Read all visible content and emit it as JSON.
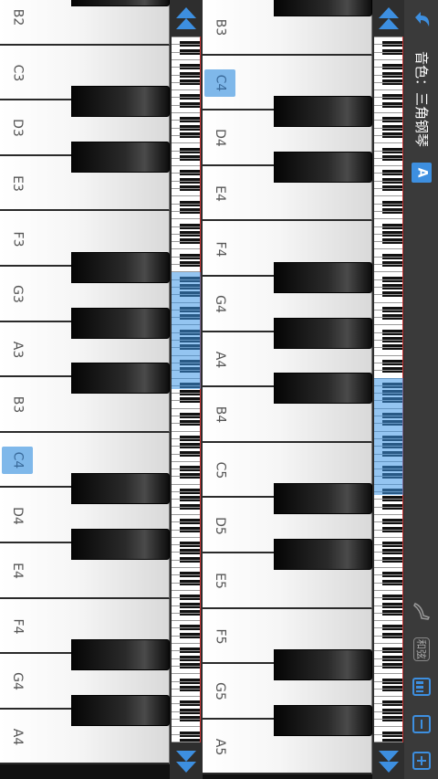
{
  "sidebar": {
    "tone_label": "音色：三角钢琴",
    "a_badge": "A",
    "chord_label": "和弦"
  },
  "left_keyboard": {
    "keys": [
      {
        "note": "B2"
      },
      {
        "note": "C3"
      },
      {
        "note": "D3"
      },
      {
        "note": "E3"
      },
      {
        "note": "F3"
      },
      {
        "note": "G3"
      },
      {
        "note": "A3"
      },
      {
        "note": "B3"
      },
      {
        "note": "C4",
        "highlight": true
      },
      {
        "note": "D4"
      },
      {
        "note": "E4"
      },
      {
        "note": "F4"
      },
      {
        "note": "G4"
      },
      {
        "note": "A4"
      }
    ]
  },
  "right_keyboard": {
    "keys": [
      {
        "note": "B3"
      },
      {
        "note": "C4",
        "highlight": true
      },
      {
        "note": "D4"
      },
      {
        "note": "E4"
      },
      {
        "note": "F4"
      },
      {
        "note": "G4"
      },
      {
        "note": "A4"
      },
      {
        "note": "B4"
      },
      {
        "note": "C5"
      },
      {
        "note": "D5"
      },
      {
        "note": "E5"
      },
      {
        "note": "F5"
      },
      {
        "note": "G5"
      },
      {
        "note": "A5"
      }
    ]
  },
  "colors": {
    "accent": "#3d8fe0",
    "selection": "#7fb8ea"
  }
}
